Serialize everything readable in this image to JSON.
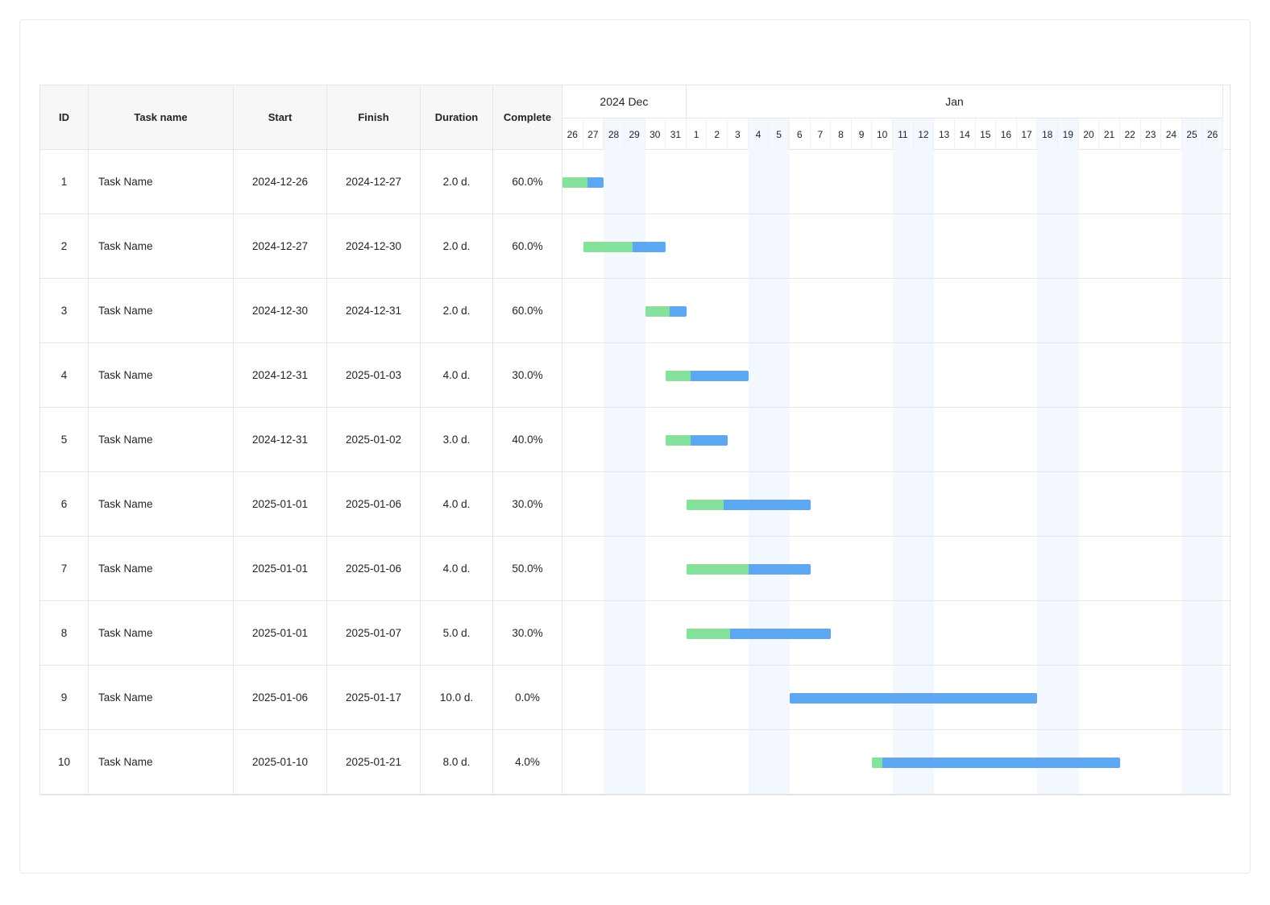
{
  "columns": {
    "id": "ID",
    "name": "Task name",
    "start": "Start",
    "finish": "Finish",
    "duration": "Duration",
    "complete": "Complete"
  },
  "timeline": {
    "start_date": "2024-12-26",
    "months": [
      {
        "label": "2024 Dec",
        "days": 6
      },
      {
        "label": "Jan",
        "days": 26
      }
    ],
    "days": [
      {
        "n": "26",
        "weekend": false
      },
      {
        "n": "27",
        "weekend": false
      },
      {
        "n": "28",
        "weekend": true
      },
      {
        "n": "29",
        "weekend": true
      },
      {
        "n": "30",
        "weekend": false
      },
      {
        "n": "31",
        "weekend": false
      },
      {
        "n": "1",
        "weekend": false
      },
      {
        "n": "2",
        "weekend": false
      },
      {
        "n": "3",
        "weekend": false
      },
      {
        "n": "4",
        "weekend": true
      },
      {
        "n": "5",
        "weekend": true
      },
      {
        "n": "6",
        "weekend": false
      },
      {
        "n": "7",
        "weekend": false
      },
      {
        "n": "8",
        "weekend": false
      },
      {
        "n": "9",
        "weekend": false
      },
      {
        "n": "10",
        "weekend": false
      },
      {
        "n": "11",
        "weekend": true
      },
      {
        "n": "12",
        "weekend": true
      },
      {
        "n": "13",
        "weekend": false
      },
      {
        "n": "14",
        "weekend": false
      },
      {
        "n": "15",
        "weekend": false
      },
      {
        "n": "16",
        "weekend": false
      },
      {
        "n": "17",
        "weekend": false
      },
      {
        "n": "18",
        "weekend": true
      },
      {
        "n": "19",
        "weekend": true
      },
      {
        "n": "20",
        "weekend": false
      },
      {
        "n": "21",
        "weekend": false
      },
      {
        "n": "22",
        "weekend": false
      },
      {
        "n": "23",
        "weekend": false
      },
      {
        "n": "24",
        "weekend": false
      },
      {
        "n": "25",
        "weekend": true
      },
      {
        "n": "26",
        "weekend": true
      }
    ]
  },
  "tasks": [
    {
      "id": "1",
      "name": "Task Name",
      "start": "2024-12-26",
      "finish": "2024-12-27",
      "duration": "2.0 d.",
      "complete": "60.0%",
      "offset": 0,
      "span": 2,
      "progress": 0.6
    },
    {
      "id": "2",
      "name": "Task Name",
      "start": "2024-12-27",
      "finish": "2024-12-30",
      "duration": "2.0 d.",
      "complete": "60.0%",
      "offset": 1,
      "span": 4,
      "progress": 0.6
    },
    {
      "id": "3",
      "name": "Task Name",
      "start": "2024-12-30",
      "finish": "2024-12-31",
      "duration": "2.0 d.",
      "complete": "60.0%",
      "offset": 4,
      "span": 2,
      "progress": 0.6
    },
    {
      "id": "4",
      "name": "Task Name",
      "start": "2024-12-31",
      "finish": "2025-01-03",
      "duration": "4.0 d.",
      "complete": "30.0%",
      "offset": 5,
      "span": 4,
      "progress": 0.3
    },
    {
      "id": "5",
      "name": "Task Name",
      "start": "2024-12-31",
      "finish": "2025-01-02",
      "duration": "3.0 d.",
      "complete": "40.0%",
      "offset": 5,
      "span": 3,
      "progress": 0.4
    },
    {
      "id": "6",
      "name": "Task Name",
      "start": "2025-01-01",
      "finish": "2025-01-06",
      "duration": "4.0 d.",
      "complete": "30.0%",
      "offset": 6,
      "span": 6,
      "progress": 0.3
    },
    {
      "id": "7",
      "name": "Task Name",
      "start": "2025-01-01",
      "finish": "2025-01-06",
      "duration": "4.0 d.",
      "complete": "50.0%",
      "offset": 6,
      "span": 6,
      "progress": 0.5
    },
    {
      "id": "8",
      "name": "Task Name",
      "start": "2025-01-01",
      "finish": "2025-01-07",
      "duration": "5.0 d.",
      "complete": "30.0%",
      "offset": 6,
      "span": 7,
      "progress": 0.3
    },
    {
      "id": "9",
      "name": "Task Name",
      "start": "2025-01-06",
      "finish": "2025-01-17",
      "duration": "10.0 d.",
      "complete": "0.0%",
      "offset": 11,
      "span": 12,
      "progress": 0.0
    },
    {
      "id": "10",
      "name": "Task Name",
      "start": "2025-01-10",
      "finish": "2025-01-21",
      "duration": "8.0 d.",
      "complete": "4.0%",
      "offset": 15,
      "span": 12,
      "progress": 0.04
    }
  ],
  "chart_data": {
    "type": "gantt",
    "x_unit": "day",
    "x_start": "2024-12-26",
    "x_end": "2025-01-26",
    "series": [
      {
        "id": 1,
        "name": "Task Name",
        "start": "2024-12-26",
        "end": "2024-12-27",
        "duration_days": 2,
        "complete_pct": 60.0
      },
      {
        "id": 2,
        "name": "Task Name",
        "start": "2024-12-27",
        "end": "2024-12-30",
        "duration_days": 2,
        "complete_pct": 60.0
      },
      {
        "id": 3,
        "name": "Task Name",
        "start": "2024-12-30",
        "end": "2024-12-31",
        "duration_days": 2,
        "complete_pct": 60.0
      },
      {
        "id": 4,
        "name": "Task Name",
        "start": "2024-12-31",
        "end": "2025-01-03",
        "duration_days": 4,
        "complete_pct": 30.0
      },
      {
        "id": 5,
        "name": "Task Name",
        "start": "2024-12-31",
        "end": "2025-01-02",
        "duration_days": 3,
        "complete_pct": 40.0
      },
      {
        "id": 6,
        "name": "Task Name",
        "start": "2025-01-01",
        "end": "2025-01-06",
        "duration_days": 4,
        "complete_pct": 30.0
      },
      {
        "id": 7,
        "name": "Task Name",
        "start": "2025-01-01",
        "end": "2025-01-06",
        "duration_days": 4,
        "complete_pct": 50.0
      },
      {
        "id": 8,
        "name": "Task Name",
        "start": "2025-01-01",
        "end": "2025-01-07",
        "duration_days": 5,
        "complete_pct": 30.0
      },
      {
        "id": 9,
        "name": "Task Name",
        "start": "2025-01-06",
        "end": "2025-01-17",
        "duration_days": 10,
        "complete_pct": 0.0
      },
      {
        "id": 10,
        "name": "Task Name",
        "start": "2025-01-10",
        "end": "2025-01-21",
        "duration_days": 8,
        "complete_pct": 4.0
      }
    ],
    "colors": {
      "bar": "#5fa7f0",
      "progress": "#85e19b",
      "weekend": "#f3f8ff"
    }
  }
}
